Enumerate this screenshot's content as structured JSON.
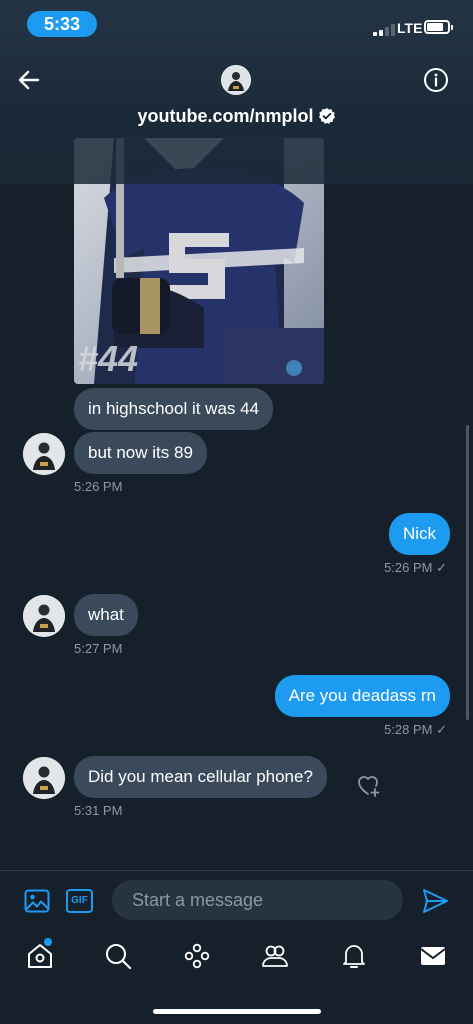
{
  "status_bar": {
    "time": "5:33",
    "network": "LTE"
  },
  "header": {
    "title": "youtube.com/nmplol"
  },
  "messages": {
    "received_1": "in highschool it was 44",
    "received_2": "but now its 89",
    "ts_1": "5:26 PM",
    "sent_1": "Nick",
    "ts_2": "5:26 PM ✓",
    "received_3": "what",
    "ts_3": "5:27 PM",
    "sent_2": "Are you deadass rn",
    "ts_4": "5:28 PM ✓",
    "received_4": "Did you mean cellular phone?",
    "ts_5": "5:31 PM"
  },
  "photo": {
    "jersey_text": "#44"
  },
  "composer": {
    "placeholder": "Start a message"
  },
  "icons": {
    "back": "arrow-left-icon",
    "info": "info-icon",
    "verified": "verified-badge-icon",
    "media": "image-icon",
    "gif": "GIF",
    "send": "send-icon",
    "reaction": "heart-plus-icon",
    "tabs": [
      "home-icon",
      "search-icon",
      "spaces-icon",
      "communities-icon",
      "notifications-icon",
      "messages-icon"
    ]
  },
  "colors": {
    "background": "#15202b",
    "accent": "#1d9bf0",
    "received_bubble": "#3b4a5b",
    "muted_text": "#8b98a5"
  }
}
